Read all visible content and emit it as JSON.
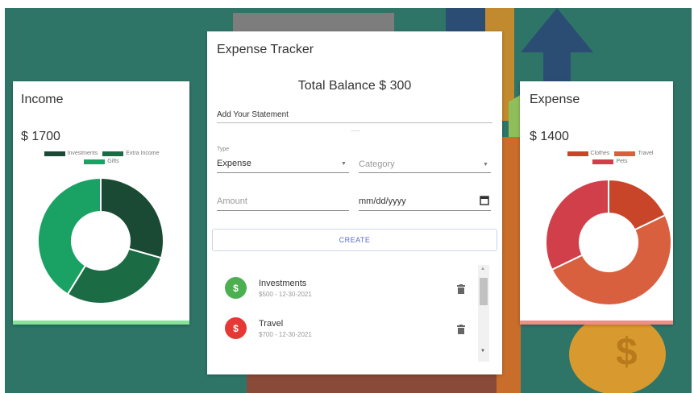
{
  "colors": {
    "background": "#2e7568",
    "income_bar": "#86e39a",
    "expense_bar": "#f28c86",
    "accent": "#5a6acf"
  },
  "income": {
    "title": "Income",
    "amount": "$ 1700",
    "legend": [
      {
        "label": "Investments",
        "color": "#1a4a34"
      },
      {
        "label": "Extra Income",
        "color": "#1b6b45"
      },
      {
        "label": "Gifts",
        "color": "#19a263"
      }
    ],
    "slices": [
      {
        "label": "Investments",
        "value": 500,
        "color": "#1a4a34"
      },
      {
        "label": "Extra Income",
        "value": 500,
        "color": "#1b6b45"
      },
      {
        "label": "Gifts",
        "value": 700,
        "color": "#19a263"
      }
    ]
  },
  "expense": {
    "title": "Expense",
    "amount": "$ 1400",
    "legend": [
      {
        "label": "Clothes",
        "color": "#c8452a"
      },
      {
        "label": "Travel",
        "color": "#d9603f"
      },
      {
        "label": "Pets",
        "color": "#d13f4a"
      }
    ],
    "slices": [
      {
        "label": "Clothes",
        "value": 250,
        "color": "#c8452a"
      },
      {
        "label": "Travel",
        "value": 700,
        "color": "#d9603f"
      },
      {
        "label": "Pets",
        "value": 450,
        "color": "#d13f4a"
      }
    ]
  },
  "tracker": {
    "title": "Expense Tracker",
    "balance": "Total Balance $ 300",
    "statement": "Add Your Statement",
    "type_label": "Type",
    "type_value": "Expense",
    "category_placeholder": "Category",
    "amount_placeholder": "Amount",
    "date_placeholder": "mm/dd/yyyy",
    "create_label": "CREATE",
    "transactions": [
      {
        "title": "Investments",
        "subtitle": "$500 - 12-30-2021",
        "kind": "income",
        "color": "#4caf50",
        "icon": "dollar-icon"
      },
      {
        "title": "Travel",
        "subtitle": "$700 - 12-30-2021",
        "kind": "expense",
        "color": "#e53935",
        "icon": "dollar-icon"
      }
    ]
  }
}
